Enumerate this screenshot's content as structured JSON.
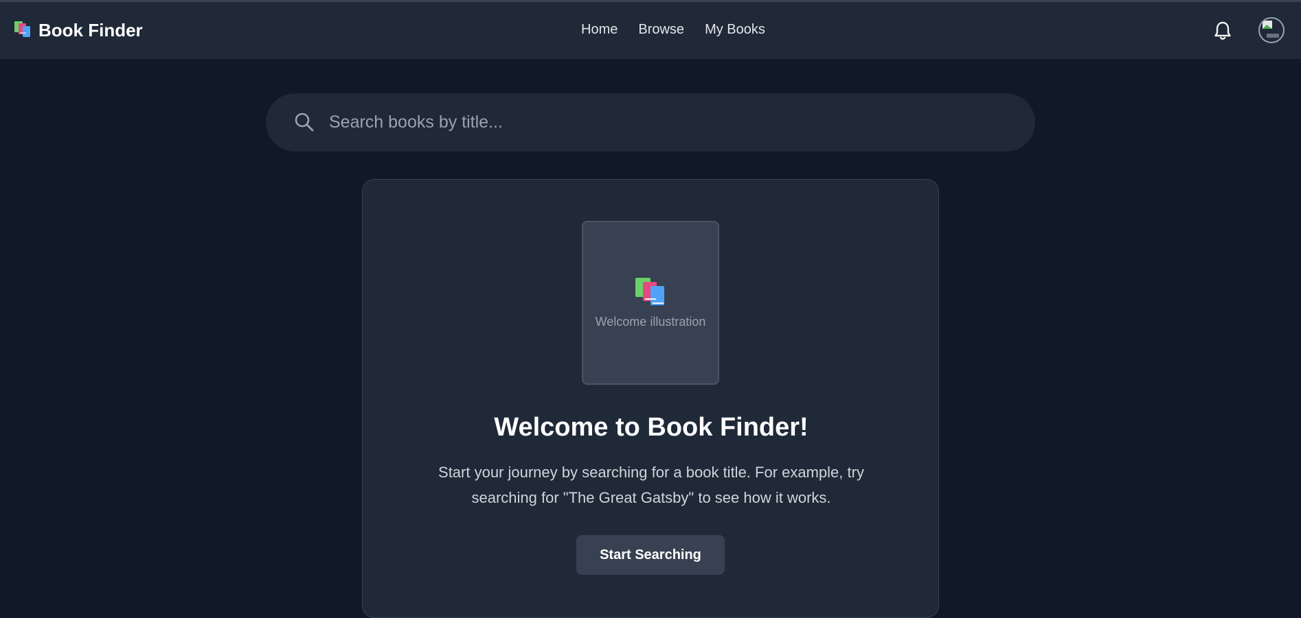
{
  "navbar": {
    "brand_icon": "books-icon",
    "brand_title": "Book Finder",
    "links": [
      {
        "label": "Home"
      },
      {
        "label": "Browse"
      },
      {
        "label": "My Books"
      }
    ],
    "notification_icon": "bell-icon",
    "avatar_icon": "user-avatar"
  },
  "search": {
    "icon": "search-icon",
    "placeholder": "Search books by title...",
    "value": ""
  },
  "welcome_card": {
    "illustration_icon": "books-icon",
    "illustration_caption": "Welcome illustration",
    "title": "Welcome to Book Finder!",
    "text": "Start your journey by searching for a book title. For example, try searching for \"The Great Gatsby\" to see how it works.",
    "button_label": "Start Searching"
  },
  "colors": {
    "background": "#111827",
    "surface": "#1f2937",
    "surface_raised": "#374151",
    "text_primary": "#ffffff",
    "text_secondary": "#d1d5db",
    "text_muted": "#9ca3af"
  }
}
